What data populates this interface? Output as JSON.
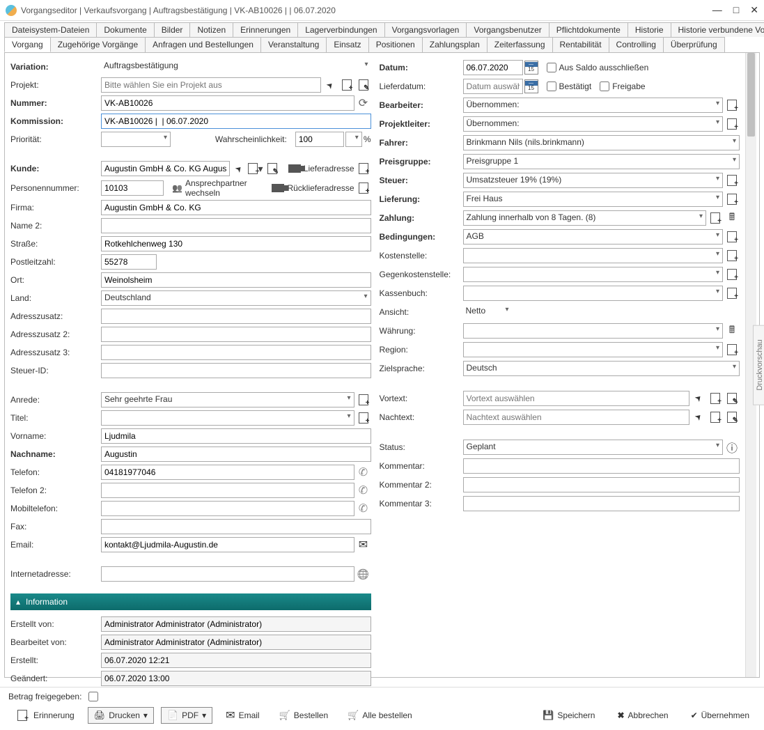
{
  "window": {
    "title": "Vorgangseditor | Verkaufsvorgang | Auftragsbestätigung | VK-AB10026 |  | 06.07.2020"
  },
  "tabs_row1": [
    "Dateisystem-Dateien",
    "Dokumente",
    "Bilder",
    "Notizen",
    "Erinnerungen",
    "Lagerverbindungen",
    "Vorgangsvorlagen",
    "Vorgangsbenutzer",
    "Pflichtdokumente",
    "Historie",
    "Historie verbundene Vorgänge"
  ],
  "tabs_row2": [
    "Vorgang",
    "Zugehörige Vorgänge",
    "Anfragen und Bestellungen",
    "Veranstaltung",
    "Einsatz",
    "Positionen",
    "Zahlungsplan",
    "Zeiterfassung",
    "Rentabilität",
    "Controlling",
    "Überprüfung"
  ],
  "active_tab": "Vorgang",
  "preview_tab_label": "Druckvorschau",
  "left": {
    "variation": {
      "label": "Variation:",
      "value": "Auftragsbestätigung"
    },
    "projekt": {
      "label": "Projekt:",
      "placeholder": "Bitte wählen Sie ein Projekt aus"
    },
    "nummer": {
      "label": "Nummer:",
      "value": "VK-AB10026"
    },
    "kommission": {
      "label": "Kommission:",
      "value": "VK-AB10026 |  | 06.07.2020"
    },
    "prioritaet": {
      "label": "Priorität:",
      "value": ""
    },
    "wahrscheinlichkeit": {
      "label": "Wahrscheinlichkeit:",
      "value": "100",
      "unit": "%"
    },
    "kunde": {
      "label": "Kunde:",
      "value": "Augustin GmbH & Co. KG August"
    },
    "lieferadresse": "Lieferadresse",
    "personennummer": {
      "label": "Personennummer:",
      "value": "10103"
    },
    "ansprechpartner_wechseln": "Ansprechpartner wechseln",
    "ruecklieferadresse": "Rücklieferadresse",
    "firma": {
      "label": "Firma:",
      "value": "Augustin GmbH & Co. KG"
    },
    "name2": {
      "label": "Name 2:",
      "value": ""
    },
    "strasse": {
      "label": "Straße:",
      "value": "Rotkehlchenweg 130"
    },
    "plz": {
      "label": "Postleitzahl:",
      "value": "55278"
    },
    "ort": {
      "label": "Ort:",
      "value": "Weinolsheim"
    },
    "land": {
      "label": "Land:",
      "value": "Deutschland"
    },
    "adresszusatz": {
      "label": "Adresszusatz:",
      "value": ""
    },
    "adresszusatz2": {
      "label": "Adresszusatz 2:",
      "value": ""
    },
    "adresszusatz3": {
      "label": "Adresszusatz 3:",
      "value": ""
    },
    "steuerid": {
      "label": "Steuer-ID:",
      "value": ""
    },
    "anrede": {
      "label": "Anrede:",
      "value": "Sehr geehrte Frau"
    },
    "titel": {
      "label": "Titel:",
      "value": ""
    },
    "vorname": {
      "label": "Vorname:",
      "value": "Ljudmila"
    },
    "nachname": {
      "label": "Nachname:",
      "value": "Augustin"
    },
    "telefon": {
      "label": "Telefon:",
      "value": "04181977046"
    },
    "telefon2": {
      "label": "Telefon 2:",
      "value": ""
    },
    "mobiltelefon": {
      "label": "Mobiltelefon:",
      "value": ""
    },
    "fax": {
      "label": "Fax:",
      "value": ""
    },
    "email": {
      "label": "Email:",
      "value": "kontakt@Ljudmila-Augustin.de"
    },
    "internet": {
      "label": "Internetadresse:",
      "value": ""
    },
    "info_section": "Information",
    "erstellt_von": {
      "label": "Erstellt von:",
      "value": "Administrator Administrator (Administrator)"
    },
    "bearbeitet_von": {
      "label": "Bearbeitet von:",
      "value": "Administrator Administrator (Administrator)"
    },
    "erstellt": {
      "label": "Erstellt:",
      "value": "06.07.2020 12:21"
    },
    "geaendert": {
      "label": "Geändert:",
      "value": "06.07.2020 13:00"
    }
  },
  "right": {
    "datum": {
      "label": "Datum:",
      "value": "06.07.2020"
    },
    "aus_saldo": "Aus Saldo ausschließen",
    "lieferdatum": {
      "label": "Lieferdatum:",
      "placeholder": "Datum auswähle"
    },
    "bestaetigt": "Bestätigt",
    "freigabe": "Freigabe",
    "bearbeiter": {
      "label": "Bearbeiter:",
      "value": "Übernommen:"
    },
    "projektleiter": {
      "label": "Projektleiter:",
      "value": "Übernommen:"
    },
    "fahrer": {
      "label": "Fahrer:",
      "value": "Brinkmann Nils (nils.brinkmann)"
    },
    "preisgruppe": {
      "label": "Preisgruppe:",
      "value": "Preisgruppe 1"
    },
    "steuer": {
      "label": "Steuer:",
      "value": "Umsatzsteuer 19% (19%)"
    },
    "lieferung": {
      "label": "Lieferung:",
      "value": "Frei Haus"
    },
    "zahlung": {
      "label": "Zahlung:",
      "value": "Zahlung innerhalb von 8 Tagen. (8)"
    },
    "bedingungen": {
      "label": "Bedingungen:",
      "value": "AGB"
    },
    "kostenstelle": {
      "label": "Kostenstelle:",
      "value": ""
    },
    "gegenkostenstelle": {
      "label": "Gegenkostenstelle:",
      "value": ""
    },
    "kassenbuch": {
      "label": "Kassenbuch:",
      "value": ""
    },
    "ansicht": {
      "label": "Ansicht:",
      "value": "Netto"
    },
    "waehrung": {
      "label": "Währung:",
      "value": ""
    },
    "region": {
      "label": "Region:",
      "value": ""
    },
    "zielsprache": {
      "label": "Zielsprache:",
      "value": "Deutsch"
    },
    "vortext": {
      "label": "Vortext:",
      "placeholder": "Vortext auswählen"
    },
    "nachtext": {
      "label": "Nachtext:",
      "placeholder": "Nachtext auswählen"
    },
    "status": {
      "label": "Status:",
      "value": "Geplant"
    },
    "kommentar": {
      "label": "Kommentar:",
      "value": ""
    },
    "kommentar2": {
      "label": "Kommentar 2:",
      "value": ""
    },
    "kommentar3": {
      "label": "Kommentar 3:",
      "value": ""
    }
  },
  "footer": {
    "betrag_freigegeben": "Betrag freigegeben:",
    "erinnerung": "Erinnerung",
    "drucken": "Drucken",
    "pdf": "PDF",
    "email": "Email",
    "bestellen": "Bestellen",
    "alle_bestellen": "Alle bestellen",
    "speichern": "Speichern",
    "abbrechen": "Abbrechen",
    "uebernehmen": "Übernehmen"
  }
}
